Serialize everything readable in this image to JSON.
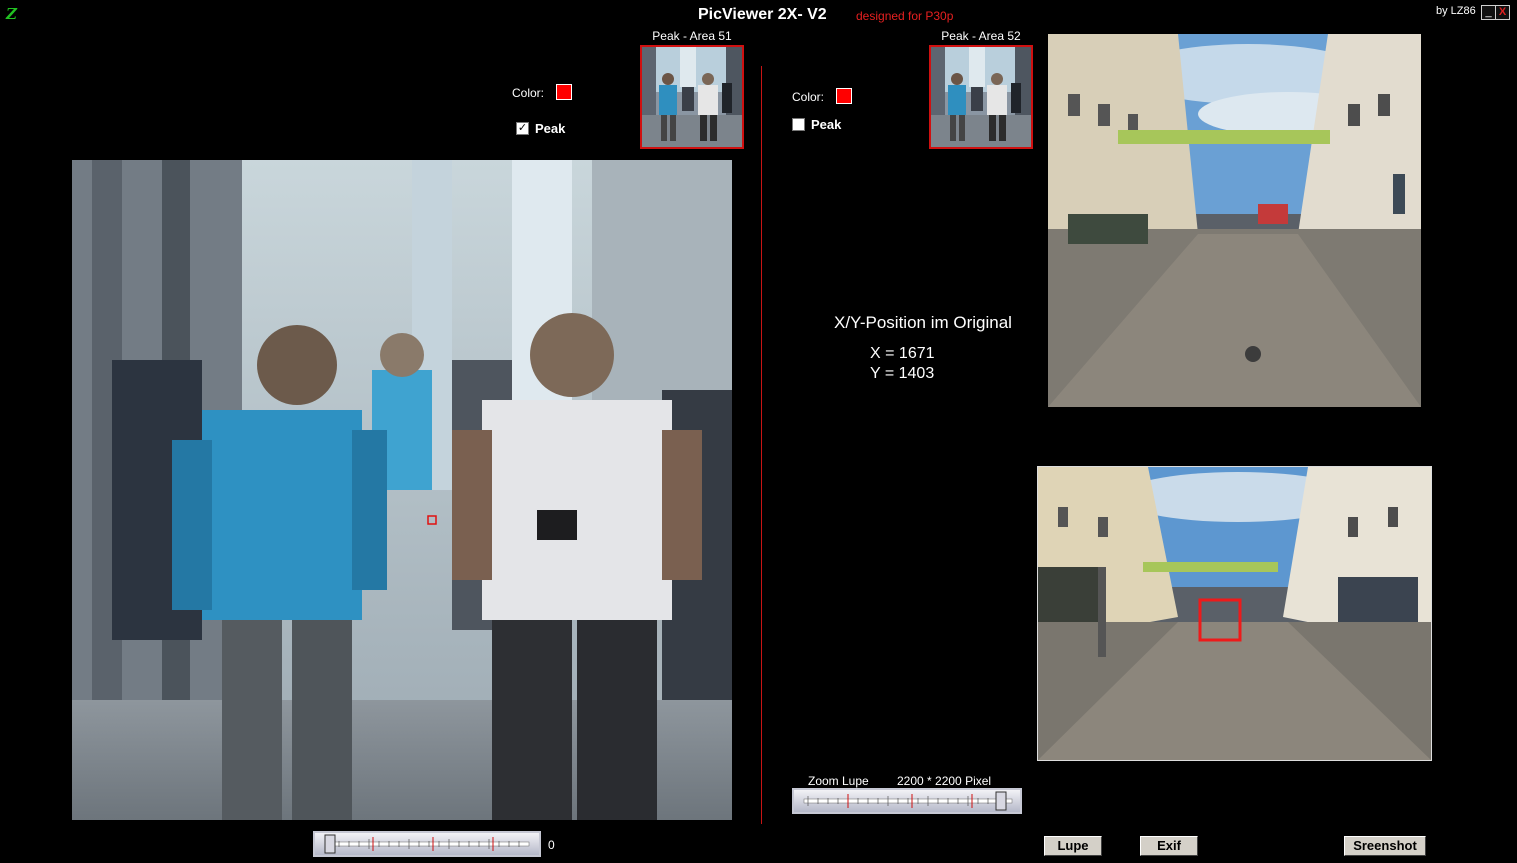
{
  "titlebar": {
    "app_icon_glyph": "Z",
    "title": "PicViewer 2X- V2",
    "designed_for": "designed for P30p",
    "author": "by LZ86",
    "minimize_glyph": "_",
    "close_glyph": "X"
  },
  "left_panel": {
    "peak_area_label": "Peak - Area 51",
    "color_label": "Color:",
    "color_value": "#ff0000",
    "peak_label": "Peak",
    "peak_checked": true,
    "slider_value": "0"
  },
  "right_panel": {
    "peak_area_label": "Peak - Area 52",
    "color_label": "Color:",
    "color_value": "#ff0000",
    "peak_label": "Peak",
    "peak_checked": false
  },
  "position": {
    "title": "X/Y-Position im Original",
    "x_label": "X =",
    "x_value": "1671",
    "y_label": "Y =",
    "y_value": "1403"
  },
  "zoom": {
    "label": "Zoom Lupe",
    "size": "2200 * 2200 Pixel"
  },
  "buttons": {
    "lupe": "Lupe",
    "exif": "Exif",
    "screenshot": "Sreenshot"
  },
  "colors": {
    "accent_red": "#d01010",
    "background": "#000000",
    "text": "#ffffff"
  }
}
